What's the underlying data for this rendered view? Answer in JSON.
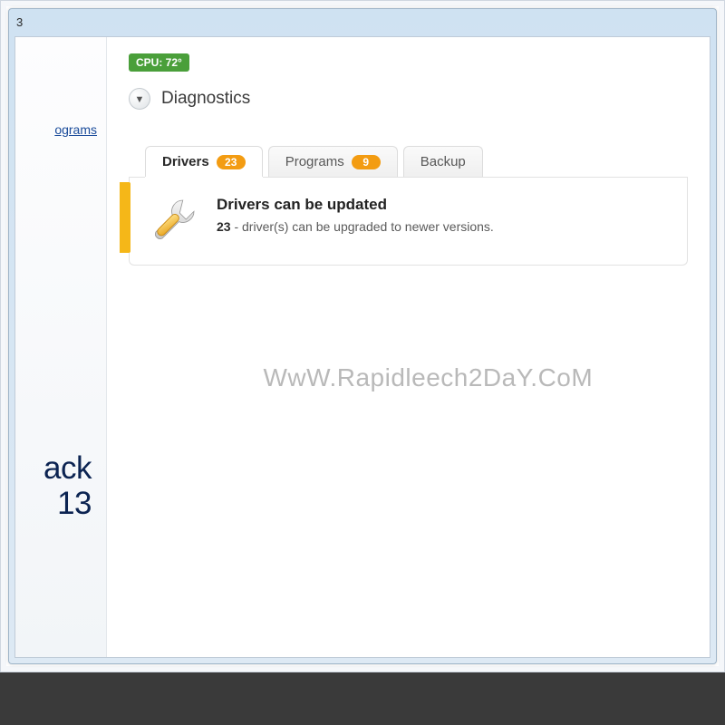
{
  "titlebar": {
    "fragment": "3"
  },
  "sidebar": {
    "link1": "ograms",
    "brand_line1": "ack",
    "brand_line2": "13"
  },
  "cpu": {
    "label": "CPU: 72°"
  },
  "section": {
    "title": "Diagnostics"
  },
  "tabs": {
    "drivers": {
      "label": "Drivers",
      "count": "23"
    },
    "programs": {
      "label": "Programs",
      "count": "9"
    },
    "backup": {
      "label": "Backup"
    }
  },
  "panel": {
    "title": "Drivers can be updated",
    "count": "23",
    "suffix": " - driver(s) can be upgraded to newer versions."
  },
  "watermark": "WwW.Rapidleech2DaY.CoM"
}
